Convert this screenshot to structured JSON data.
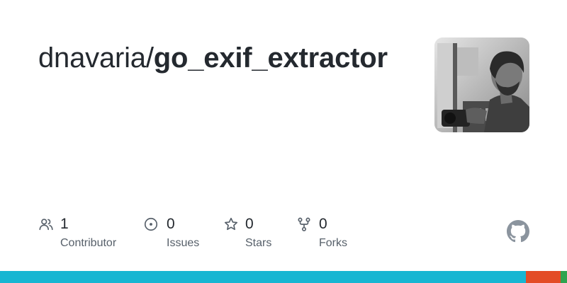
{
  "repo": {
    "owner": "dnavaria",
    "separator": "/",
    "name": "go_exif_extractor"
  },
  "avatar": {
    "alt": "dnavaria avatar"
  },
  "stats": [
    {
      "icon": "contributors-icon",
      "value": "1",
      "label": "Contributor"
    },
    {
      "icon": "issues-icon",
      "value": "0",
      "label": "Issues"
    },
    {
      "icon": "star-icon",
      "value": "0",
      "label": "Stars"
    },
    {
      "icon": "fork-icon",
      "value": "0",
      "label": "Forks"
    }
  ],
  "logo": {
    "icon": "github-icon",
    "color": "#8b949e"
  },
  "languages": [
    {
      "color": "#17b6d2",
      "share": 0.928
    },
    {
      "color": "#e34c26",
      "share": 0.061
    },
    {
      "color": "#2ea44f",
      "share": 0.011
    }
  ],
  "colors": {
    "title": "#24292f",
    "label": "#57606a",
    "icon": "#57606a"
  }
}
